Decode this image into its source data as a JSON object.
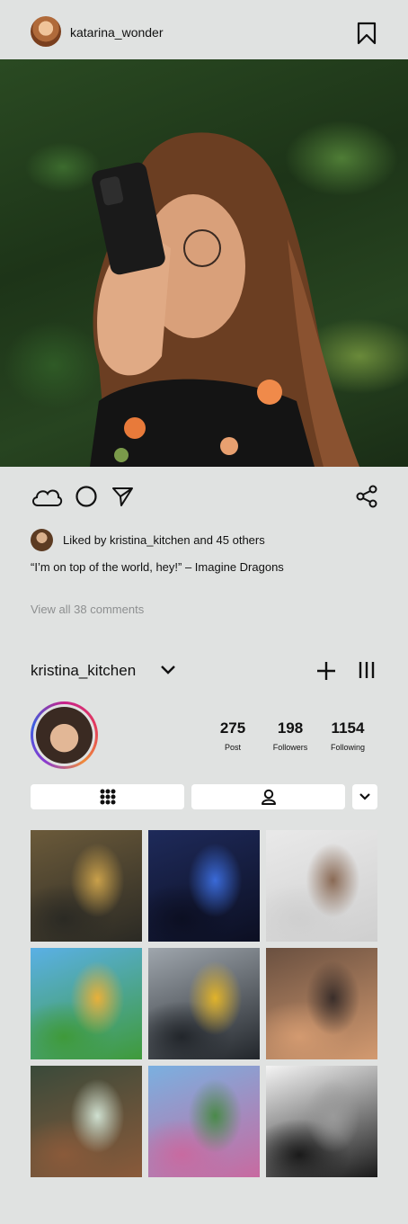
{
  "post": {
    "username": "katarina_wonder",
    "liked_by_text": "Liked by kristina_kitchen and 45 others",
    "caption": "“I’m on top of the world, hey!” – Imagine Dragons",
    "view_comments": "View all 38 comments"
  },
  "profile": {
    "username": "kristina_kitchen",
    "stats": [
      {
        "value": "275",
        "label": "Post"
      },
      {
        "value": "198",
        "label": "Followers"
      },
      {
        "value": "1154",
        "label": "Following"
      }
    ]
  },
  "grid": [
    {
      "name": "grid-photo-soldier",
      "colors": [
        "#6b5a3a",
        "#2b2a24",
        "#c9a04a"
      ]
    },
    {
      "name": "grid-photo-party",
      "colors": [
        "#1e2a5a",
        "#0c0f22",
        "#3a6ad8"
      ]
    },
    {
      "name": "grid-photo-dancers",
      "colors": [
        "#e9e9e9",
        "#cfcfcf",
        "#8a6a55"
      ]
    },
    {
      "name": "grid-photo-game",
      "colors": [
        "#5ab0e6",
        "#3f9a3a",
        "#e8b03a"
      ]
    },
    {
      "name": "grid-photo-hockey",
      "colors": [
        "#9fa6ad",
        "#22262b",
        "#e1b32a"
      ]
    },
    {
      "name": "grid-photo-selfie",
      "colors": [
        "#6a5040",
        "#d39a70",
        "#3a2e2a"
      ]
    },
    {
      "name": "grid-photo-smiling-woman",
      "colors": [
        "#3a4a3a",
        "#8a5a3a",
        "#cfe0d0"
      ]
    },
    {
      "name": "grid-photo-sims",
      "colors": [
        "#7ab0e0",
        "#c86aa0",
        "#4a8a4a"
      ]
    },
    {
      "name": "grid-photo-manga",
      "colors": [
        "#f4f4f4",
        "#1a1a1a",
        "#9a9a9a"
      ]
    }
  ]
}
